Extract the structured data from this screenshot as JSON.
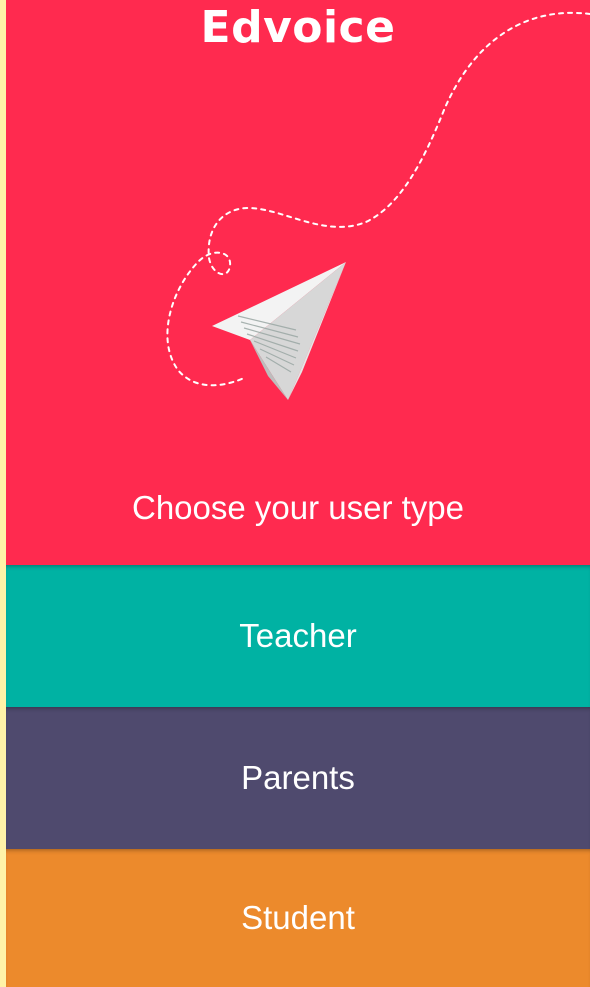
{
  "app": {
    "brand": "Edvoice"
  },
  "hero": {
    "illustration_icon": "paper-plane-icon",
    "prompt": "Choose your user type"
  },
  "user_types": [
    {
      "label": "Teacher",
      "color": "#00B2A3"
    },
    {
      "label": "Parents",
      "color": "#4F4A6E"
    },
    {
      "label": "Student",
      "color": "#EC8A2C"
    }
  ],
  "colors": {
    "hero_background": "#FF2A4F",
    "frame_background": "#FFF3A8",
    "text": "#FFFFFF"
  }
}
